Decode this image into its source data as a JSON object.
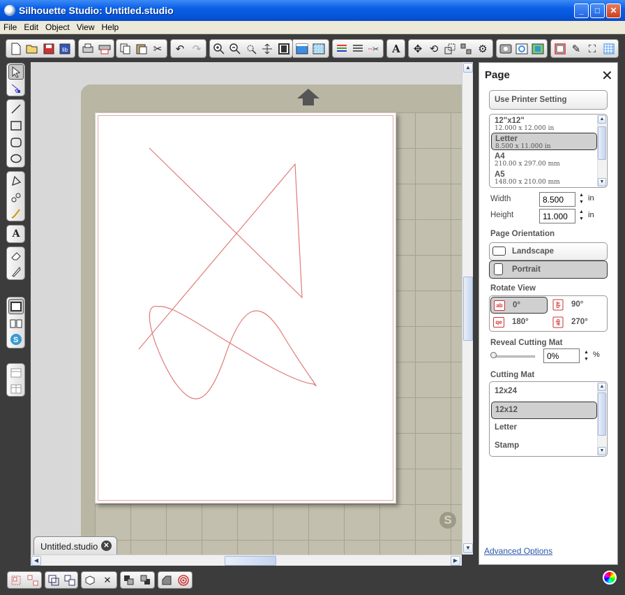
{
  "window": {
    "title": "Silhouette Studio: Untitled.studio",
    "min": "_",
    "max": "□",
    "close": "✕"
  },
  "menu": [
    "File",
    "Edit",
    "Object",
    "View",
    "Help"
  ],
  "document_tab": {
    "label": "Untitled.studio",
    "close": "✕"
  },
  "canvas": {
    "logo": "S"
  },
  "panel": {
    "title": "Page",
    "close": "✕",
    "use_printer_setting": "Use Printer Setting",
    "page_sizes": [
      {
        "name": "12\"x12\"",
        "dims": "12.000 x 12.000 in",
        "selected": false
      },
      {
        "name": "Letter",
        "dims": "8.500 x 11.000 in",
        "selected": true
      },
      {
        "name": "A4",
        "dims": "210.00 x 297.00 mm",
        "selected": false
      },
      {
        "name": "A5",
        "dims": "148.00 x 210.00 mm",
        "selected": false
      }
    ],
    "width_label": "Width",
    "width_value": "8.500",
    "width_unit": "in",
    "height_label": "Height",
    "height_value": "11.000",
    "height_unit": "in",
    "orientation_label": "Page Orientation",
    "orientation": [
      {
        "label": "Landscape",
        "selected": false
      },
      {
        "label": "Portrait",
        "selected": true
      }
    ],
    "rotate_label": "Rotate View",
    "rotate": [
      {
        "label": "0°",
        "icon": "ab",
        "selected": true
      },
      {
        "label": "90°",
        "icon": "ab",
        "selected": false
      },
      {
        "label": "180°",
        "icon": "qe",
        "selected": false
      },
      {
        "label": "270°",
        "icon": "ab",
        "selected": false
      }
    ],
    "reveal_label": "Reveal Cutting Mat",
    "reveal_value": "0%",
    "reveal_unit": "%",
    "reveal_level": 0,
    "cutting_mat_label": "Cutting Mat",
    "cutting_mats": [
      {
        "name": "12x24",
        "selected": false
      },
      {
        "name": "12x12",
        "selected": true
      },
      {
        "name": "Letter",
        "selected": false
      },
      {
        "name": "Stamp",
        "selected": false
      }
    ],
    "advanced": "Advanced Options"
  },
  "colors": {
    "accent": "#0554d8",
    "cut_line": "#e07a7a",
    "mat": "#b9b6a3",
    "panel_bg": "#ffffff"
  }
}
